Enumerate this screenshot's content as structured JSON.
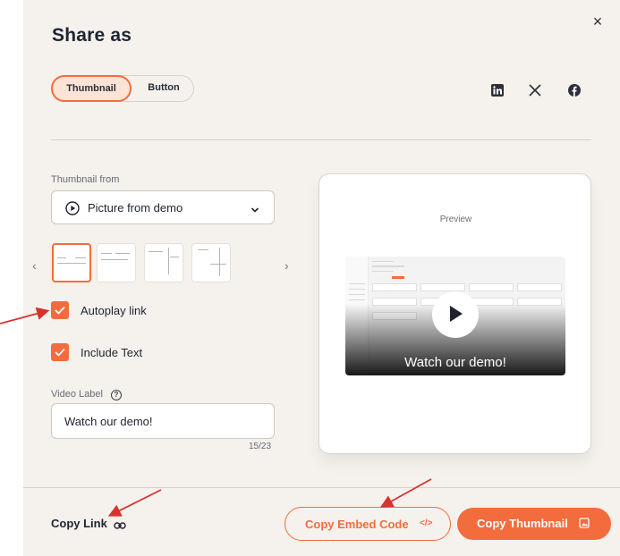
{
  "dialog": {
    "title": "Share as",
    "close_symbol": "×"
  },
  "mode_toggle": {
    "options": [
      "Thumbnail",
      "Button"
    ],
    "selected": "Thumbnail"
  },
  "social": [
    "linkedin-icon",
    "x-icon",
    "facebook-icon"
  ],
  "thumbnail_from": {
    "label": "Thumbnail from",
    "value": "Picture from demo"
  },
  "thumbnail_carousel": {
    "prev": "‹",
    "next": "›",
    "count": 4,
    "selected_index": 0
  },
  "autoplay": {
    "label": "Autoplay link",
    "checked": true
  },
  "include_text": {
    "label": "Include Text",
    "checked": true
  },
  "video_label": {
    "label": "Video Label",
    "help": "?",
    "value": "Watch our demo!",
    "counter": "15/23"
  },
  "preview": {
    "title": "Preview",
    "caption": "Watch our demo!"
  },
  "footer": {
    "copy_link": "Copy Link",
    "copy_embed": "Copy Embed Code",
    "copy_embed_icon": "</>",
    "copy_thumbnail": "Copy Thumbnail"
  },
  "colors": {
    "accent": "#f36c3d",
    "panel_bg": "#f5f1ed",
    "annotation": "#d8322c"
  }
}
